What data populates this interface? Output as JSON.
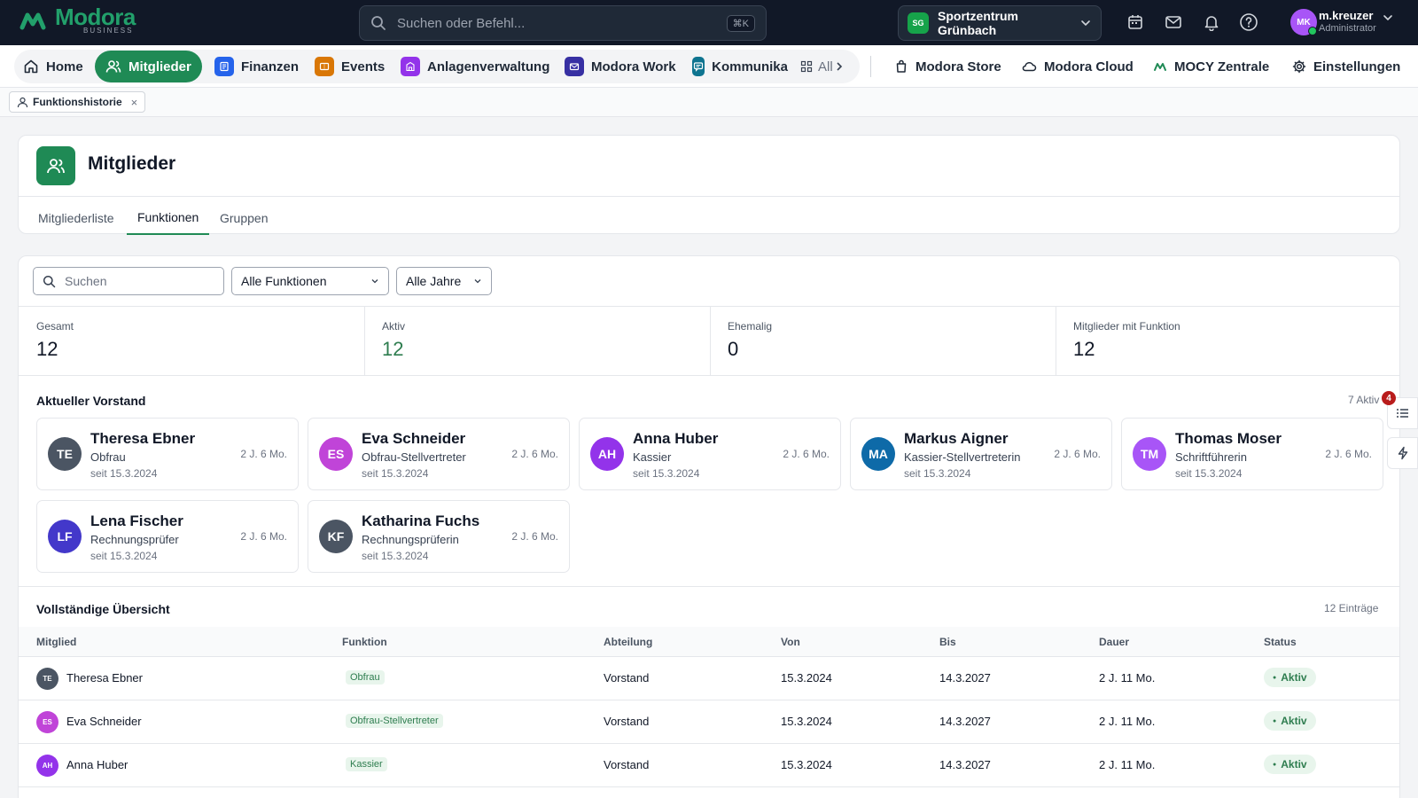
{
  "topbar": {
    "logo_name": "Modora",
    "logo_sub": "BUSINESS",
    "search_placeholder": "Suchen oder Befehl...",
    "search_shortcut": "⌘K",
    "org_badge": "SG",
    "org_name": "Sportzentrum Grünbach",
    "user_initials": "MK",
    "user_name": "m.kreuzer",
    "user_role": "Administrator"
  },
  "nav": {
    "home": "Home",
    "members": "Mitglieder",
    "finance": "Finanzen",
    "events": "Events",
    "facilities": "Anlagenverwaltung",
    "work": "Modora Work",
    "communication": "Kommunika",
    "all": "All",
    "store": "Modora Store",
    "cloud": "Modora Cloud",
    "mocy": "MOCY Zentrale",
    "settings": "Einstellungen"
  },
  "tabstrip": {
    "chip_label": "Funktionshistorie"
  },
  "page": {
    "title": "Mitglieder",
    "tabs": [
      "Mitgliederliste",
      "Funktionen",
      "Gruppen"
    ]
  },
  "filters": {
    "search_placeholder": "Suchen",
    "function_select": "Alle Funktionen",
    "year_select": "Alle Jahre"
  },
  "stats": [
    {
      "label": "Gesamt",
      "value": "12"
    },
    {
      "label": "Aktiv",
      "value": "12"
    },
    {
      "label": "Ehemalig",
      "value": "0"
    },
    {
      "label": "Mitglieder mit Funktion",
      "value": "12"
    }
  ],
  "board": {
    "title": "Aktueller Vorstand",
    "meta": "7 Aktiv",
    "notif_count": "4",
    "people": [
      {
        "initials": "TE",
        "name": "Theresa Ebner",
        "role": "Obfrau",
        "since": "seit 15.3.2024",
        "duration": "2 J. 6 Mo.",
        "color": "#4b5563"
      },
      {
        "initials": "ES",
        "name": "Eva Schneider",
        "role": "Obfrau-Stellvertreter",
        "since": "seit 15.3.2024",
        "duration": "2 J. 6 Mo.",
        "color": "#c044d8"
      },
      {
        "initials": "AH",
        "name": "Anna Huber",
        "role": "Kassier",
        "since": "seit 15.3.2024",
        "duration": "2 J. 6 Mo.",
        "color": "#9333ea"
      },
      {
        "initials": "MA",
        "name": "Markus Aigner",
        "role": "Kassier-Stellvertreterin",
        "since": "seit 15.3.2024",
        "duration": "2 J. 6 Mo.",
        "color": "#0e6aa8"
      },
      {
        "initials": "TM",
        "name": "Thomas Moser",
        "role": "Schriftführerin",
        "since": "seit 15.3.2024",
        "duration": "2 J. 6 Mo.",
        "color": "#a855f7"
      },
      {
        "initials": "LF",
        "name": "Lena Fischer",
        "role": "Rechnungsprüfer",
        "since": "seit 15.3.2024",
        "duration": "2 J. 6 Mo.",
        "color": "#4338ca"
      },
      {
        "initials": "KF",
        "name": "Katharina Fuchs",
        "role": "Rechnungsprüferin",
        "since": "seit 15.3.2024",
        "duration": "2 J. 6 Mo.",
        "color": "#4b5563"
      }
    ]
  },
  "overview": {
    "title": "Vollständige Übersicht",
    "meta": "12 Einträge",
    "columns": [
      "Mitglied",
      "Funktion",
      "Abteilung",
      "Von",
      "Bis",
      "Dauer",
      "Status"
    ],
    "rows": [
      {
        "initials": "TE",
        "member": "Theresa Ebner",
        "function": "Obfrau",
        "department": "Vorstand",
        "from": "15.3.2024",
        "to": "14.3.2027",
        "duration": "2 J. 11 Mo.",
        "status": "Aktiv",
        "color": "#4b5563"
      },
      {
        "initials": "ES",
        "member": "Eva Schneider",
        "function": "Obfrau-Stellvertreter",
        "department": "Vorstand",
        "from": "15.3.2024",
        "to": "14.3.2027",
        "duration": "2 J. 11 Mo.",
        "status": "Aktiv",
        "color": "#c044d8"
      },
      {
        "initials": "AH",
        "member": "Anna Huber",
        "function": "Kassier",
        "department": "Vorstand",
        "from": "15.3.2024",
        "to": "14.3.2027",
        "duration": "2 J. 11 Mo.",
        "status": "Aktiv",
        "color": "#9333ea"
      }
    ]
  }
}
